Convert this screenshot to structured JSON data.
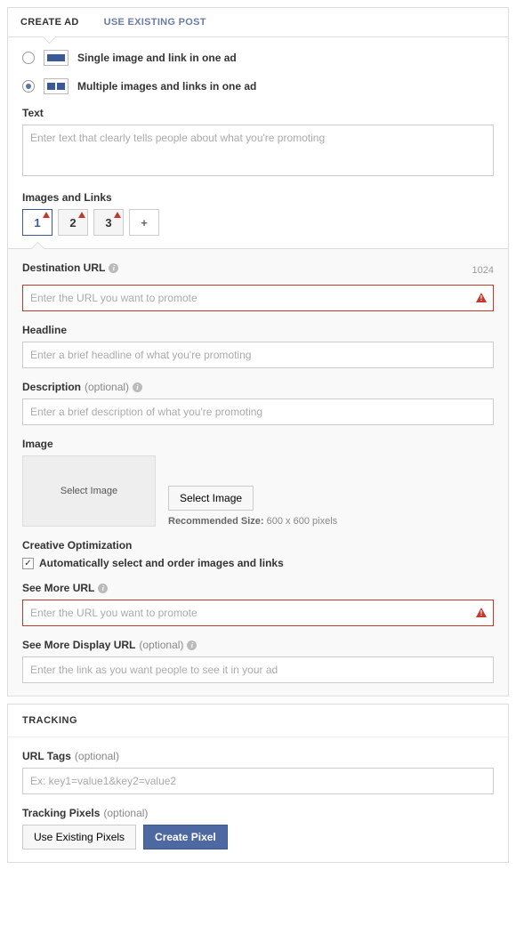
{
  "tabs": {
    "create": "CREATE AD",
    "existing": "USE EXISTING POST"
  },
  "format": {
    "single": "Single image and link in one ad",
    "multi": "Multiple images and links in one ad"
  },
  "text": {
    "label": "Text",
    "placeholder": "Enter text that clearly tells people about what you're promoting"
  },
  "images_links": {
    "label": "Images and Links",
    "tabs": [
      "1",
      "2",
      "3"
    ],
    "plus": "+"
  },
  "dest": {
    "label": "Destination URL",
    "counter": "1024",
    "placeholder": "Enter the URL you want to promote"
  },
  "headline": {
    "label": "Headline",
    "placeholder": "Enter a brief headline of what you're promoting"
  },
  "desc": {
    "label": "Description",
    "optional": "(optional)",
    "placeholder": "Enter a brief description of what you're promoting"
  },
  "image": {
    "label": "Image",
    "drop": "Select Image",
    "btn": "Select Image",
    "rec_prefix": "Recommended Size: ",
    "rec_val": "600 x 600 pixels"
  },
  "creative": {
    "label": "Creative Optimization",
    "auto": "Automatically select and order images and links"
  },
  "seemore": {
    "label": "See More URL",
    "placeholder": "Enter the URL you want to promote"
  },
  "seemore_disp": {
    "label": "See More Display URL",
    "optional": "(optional)",
    "placeholder": "Enter the link as you want people to see it in your ad"
  },
  "tracking": {
    "head": "TRACKING",
    "urltags": {
      "label": "URL Tags",
      "optional": "(optional)",
      "placeholder": "Ex: key1=value1&key2=value2"
    },
    "pixels": {
      "label": "Tracking Pixels",
      "optional": "(optional)",
      "existing": "Use Existing Pixels",
      "create": "Create Pixel"
    }
  }
}
